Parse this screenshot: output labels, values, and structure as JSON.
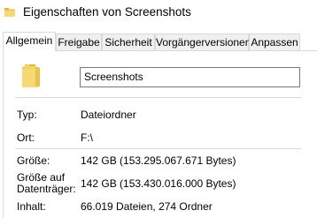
{
  "window": {
    "title": "Eigenschaften von Screenshots",
    "icon": "folder-icon"
  },
  "tabs": [
    {
      "label": "Allgemein",
      "active": true
    },
    {
      "label": "Freigabe",
      "active": false
    },
    {
      "label": "Sicherheit",
      "active": false
    },
    {
      "label": "Vorgängerversionen",
      "active": false
    },
    {
      "label": "Anpassen",
      "active": false
    }
  ],
  "general": {
    "folder_icon": "folder-icon",
    "name_value": "Screenshots",
    "type_label": "Typ:",
    "type_value": "Dateiordner",
    "location_label": "Ort:",
    "location_value": "F:\\",
    "size_label": "Größe:",
    "size_value": "142 GB (153.295.067.671 Bytes)",
    "size_on_disk_label": "Größe auf Datenträger:",
    "size_on_disk_value": "142 GB (153.430.016.000 Bytes)",
    "contents_label": "Inhalt:",
    "contents_value": "66.019 Dateien, 274 Ordner"
  },
  "colors": {
    "folder_yellow": "#f8d775",
    "folder_dark": "#e0b437",
    "tab_inactive_bg": "#f0f0f0",
    "border": "#d9d9d9"
  }
}
